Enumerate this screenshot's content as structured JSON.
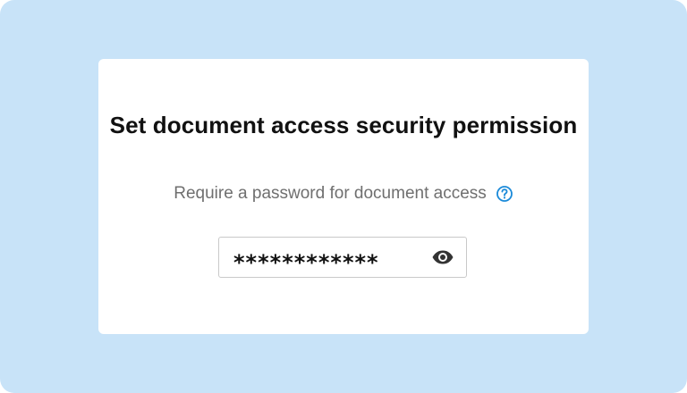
{
  "dialog": {
    "title": "Set document access security permission",
    "subtitle": "Require a password for document access",
    "help_icon": "question-circle-icon",
    "password": {
      "masked_value": "************",
      "visibility_icon": "eye-icon"
    }
  },
  "colors": {
    "backdrop": "#c8e3f8",
    "card": "#ffffff",
    "title_text": "#111111",
    "subtitle_text": "#6f6f6f",
    "help_icon": "#1a8ad9",
    "field_border": "#c9c9c9",
    "eye_icon": "#333333"
  }
}
